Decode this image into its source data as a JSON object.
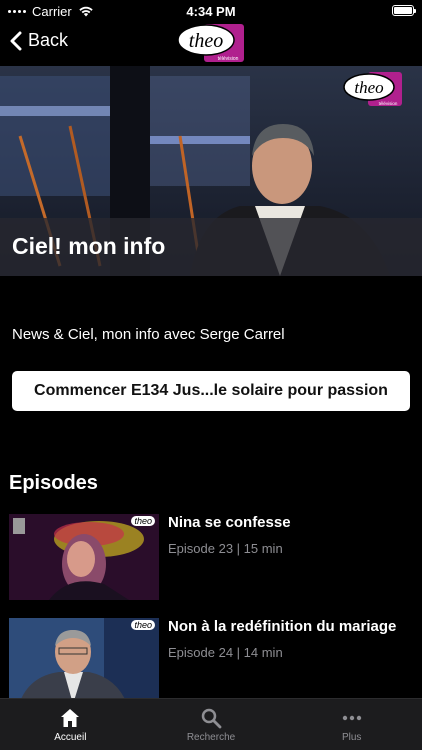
{
  "status": {
    "carrier": "Carrier",
    "time": "4:34 PM"
  },
  "nav": {
    "back_label": "Back",
    "logo_text": "theo",
    "logo_sub": "télévision"
  },
  "hero": {
    "title": "Ciel! mon info",
    "logo_text": "theo",
    "logo_sub": "télévision"
  },
  "show": {
    "subtitle": "News & Ciel, mon info avec Serge Carrel",
    "start_label": "Commencer E134 Jus...le solaire pour passion"
  },
  "episodes_section": {
    "title": "Episodes",
    "items": [
      {
        "title": "Nina se confesse",
        "meta": "Episode 23 | 15 min",
        "badge": "theo"
      },
      {
        "title": "Non à la redéfinition du mariage",
        "meta": "Episode 24 | 14 min",
        "badge": "theo"
      }
    ]
  },
  "tabs": [
    {
      "label": "Accueil",
      "icon": "home-icon",
      "active": true
    },
    {
      "label": "Recherche",
      "icon": "search-icon",
      "active": false
    },
    {
      "label": "Plus",
      "icon": "more-icon",
      "active": false
    }
  ],
  "colors": {
    "background": "#000000",
    "logo_accent": "#b0208e",
    "tab_bar": "#1c1c1e",
    "meta_text": "#8e8e93"
  }
}
